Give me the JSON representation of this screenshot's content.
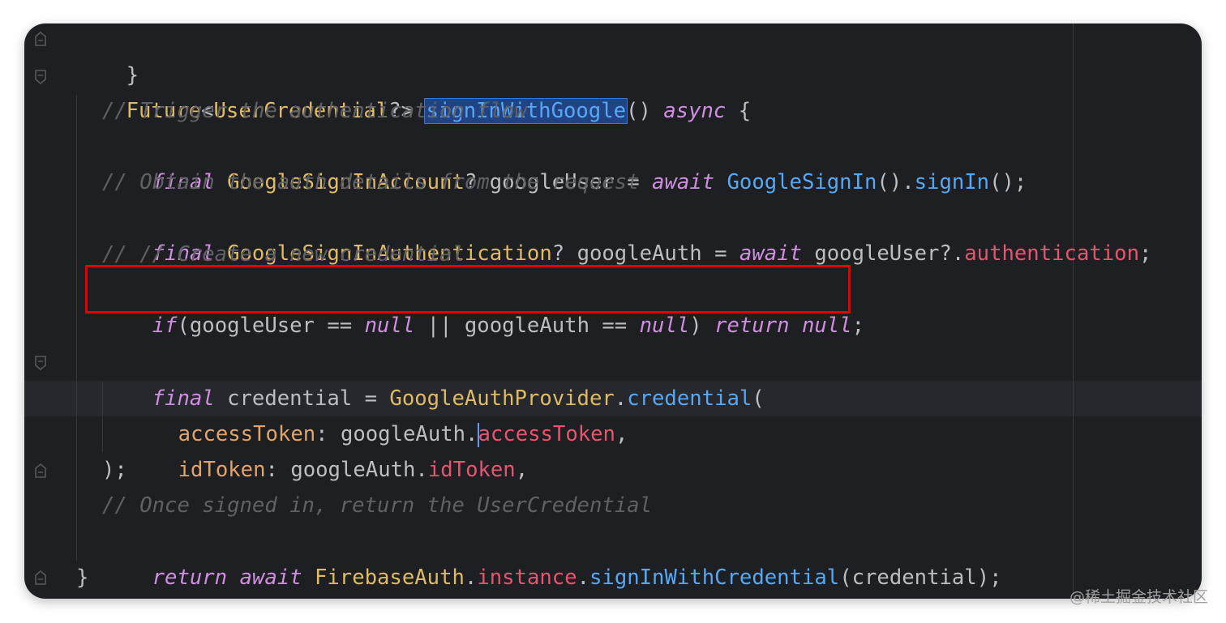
{
  "colors": {
    "background": "#1e1f22",
    "keyword": "#cf8ee0",
    "comment": "#5f6166",
    "class": "#e0bb65",
    "function": "#56a8f5",
    "property": "#e4566f",
    "parameter": "#e0a46c",
    "plain": "#bcbec4",
    "annotation_box": "#e60000"
  },
  "code": {
    "l1": {
      "text": "}"
    },
    "l2": {
      "a": "Future",
      "b": "<",
      "c": "UserCredential",
      "d": "?> ",
      "e": "signInWithGoogle",
      "f": "() ",
      "g": "async",
      "h": " {"
    },
    "l3": {
      "text": "// Trigger the authentication flow"
    },
    "l4": {
      "a": "final",
      "b": " ",
      "c": "GoogleSignInAccount",
      "d": "? googleUser = ",
      "e": "await",
      "f": " ",
      "g": "GoogleSignIn",
      "h": "().",
      "i": "signIn",
      "j": "();"
    },
    "l5": {
      "text": "// Obtain the auth details from the request"
    },
    "l6": {
      "a": "final",
      "b": " ",
      "c": "GoogleSignInAuthentication",
      "d": "? googleAuth = ",
      "e": "await",
      "f": " googleUser?.",
      "g": "authentication",
      "h": ";"
    },
    "l7": {
      "text": "// // Create a new credential"
    },
    "l8": {
      "a": "if",
      "b": "(googleUser == ",
      "c": "null",
      "d": " || googleAuth == ",
      "e": "null",
      "f": ") ",
      "g": "return",
      "h": " ",
      "i": "null",
      "j": ";"
    },
    "l10": {
      "a": "final",
      "b": " credential = ",
      "c": "GoogleAuthProvider",
      "d": ".",
      "e": "credential",
      "f": "("
    },
    "l11": {
      "a": "accessToken",
      "b": ": googleAuth.",
      "c": "accessToken",
      "d": ","
    },
    "l12": {
      "a": "idToken",
      "b": ": googleAuth.",
      "c": "idToken",
      "d": ","
    },
    "l13": {
      "text": ");"
    },
    "l14": {
      "text": "// Once signed in, return the UserCredential"
    },
    "l15": {
      "a": "return",
      "b": " ",
      "c": "await",
      "d": " ",
      "e": "FirebaseAuth",
      "f": ".",
      "g": "instance",
      "h": ".",
      "i": "signInWithCredential",
      "j": "(credential);"
    },
    "l16": {
      "text": "}"
    }
  },
  "icons": [
    "fold-end-icon",
    "fold-start-icon"
  ],
  "watermark": "@稀土掘金技术社区"
}
